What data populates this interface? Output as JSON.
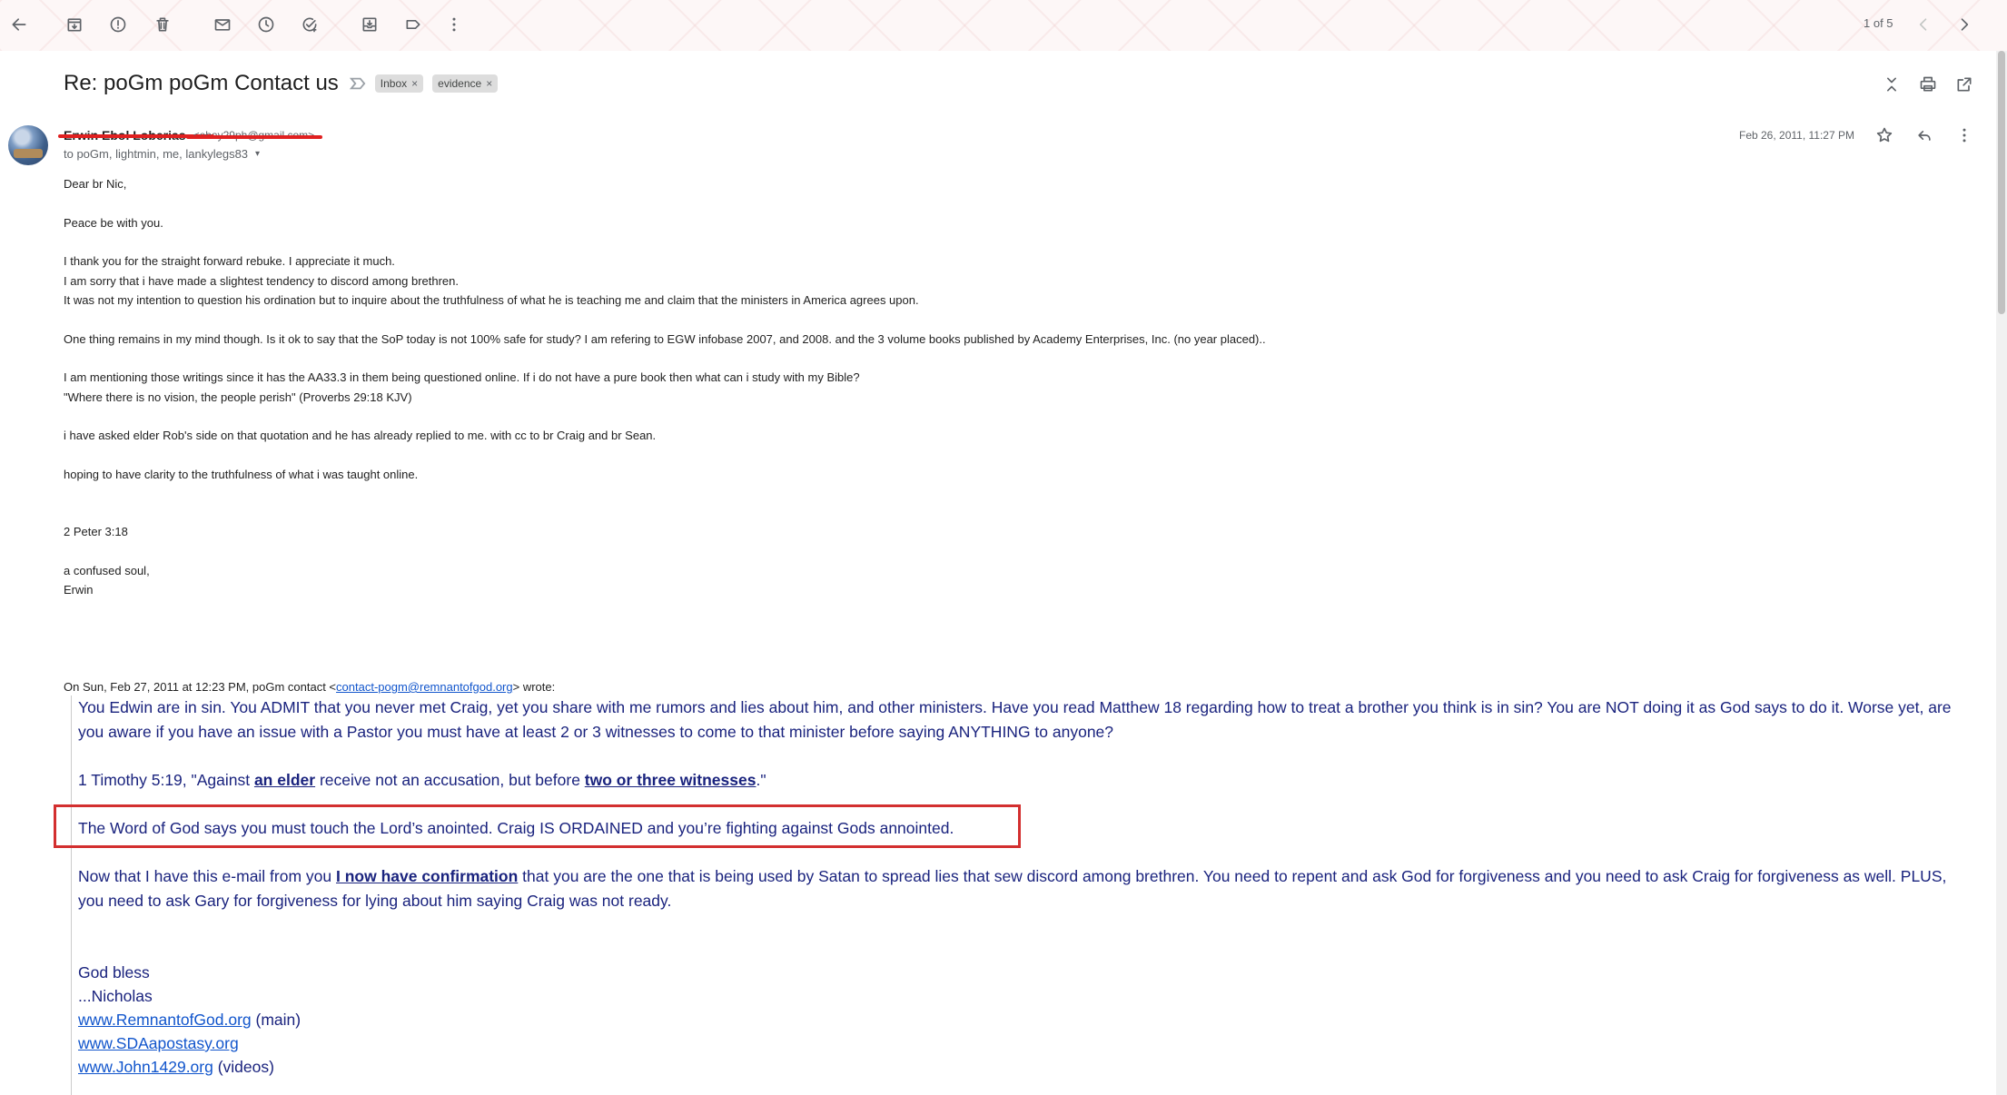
{
  "toolbar": {
    "icons": [
      "back-arrow-icon",
      "archive-icon",
      "report-spam-icon",
      "delete-icon",
      "mark-unread-icon",
      "snooze-icon",
      "add-to-tasks-icon",
      "move-to-icon",
      "labels-icon",
      "more-vert-icon"
    ],
    "pager": "1 of 5"
  },
  "subject": {
    "title": "Re: poGm poGm Contact us",
    "labels": [
      "Inbox",
      "evidence"
    ],
    "close_x": "×"
  },
  "sender": {
    "name": "Erwin  Ebol  Loberias",
    "email": "<ebay29ph@gmail.com>",
    "recipients": "to poGm, lightmin, me, lankylegs83",
    "date": "Feb 26, 2011, 11:27 PM",
    "caret": "▾"
  },
  "body": {
    "greeting": "Dear br Nic,",
    "peace": "Peace be with you.",
    "p1_l1": "I thank you for the straight forward rebuke. I appreciate it much.",
    "p1_l2": "I am sorry that i have made a slightest tendency to discord among brethren.",
    "p1_l3": "It was not my intention to question his ordination but to inquire about the truthfulness of what he is teaching me and claim that the ministers in America agrees upon.",
    "p2": "One thing remains in my mind though. Is it ok to say that the SoP today is not 100% safe for study? I am refering to EGW infobase 2007, and 2008. and the 3 volume books published by Academy Enterprises, Inc. (no year placed)..",
    "p3_l1": "I am mentioning those writings since it has the AA33.3 in them being questioned online. If i do not have a pure book then what can i study with my Bible?",
    "p3_l2": "\"Where there is no vision, the people perish\" (Proverbs 29:18 KJV)",
    "p4": "i have asked elder Rob's side on that quotation and he has already replied to me. with cc to br Craig and br Sean.",
    "p5": "hoping to have clarity to the truthfulness of what i was taught online.",
    "verse": "2 Peter 3:18",
    "closing": "a confused soul,",
    "signoff": "Erwin"
  },
  "quote_header": {
    "prefix": "On Sun, Feb 27, 2011 at 12:23 PM, poGm contact <",
    "email": "contact-pogm@remnantofgod.org",
    "suffix": "> wrote:"
  },
  "quote": {
    "p1": "You Edwin are in sin. You ADMIT that you never met Craig, yet you share with me rumors and lies about him, and other ministers. Have you read Matthew 18 regarding how to treat a brother you think is in sin? You are NOT doing it as God says to do it. Worse yet, are you aware if you have an issue with a Pastor you must have at least 2 or 3 witnesses to come to that minister before saying ANYTHING to anyone?",
    "p2_a": "1 Timothy 5:19, \"Against ",
    "p2_link1": "an elder",
    "p2_b": " receive not an accusation, but before ",
    "p2_link2": "two or three witnesses",
    "p2_c": ".\"",
    "p3": "The Word of God says you must touch the Lord’s anointed. Craig IS ORDAINED and you’re fighting against Gods annointed.",
    "p4_a": "Now that I have this e-mail from you ",
    "p4_link": "I now have confirmation",
    "p4_b": " that you are the one that is being used by Satan to spread lies that sew discord among brethren. You need to repent and ask God for forgiveness and you need to ask Craig for forgiveness as well. PLUS, you need to ask Gary for forgiveness for lying about him saying Craig was not ready.",
    "sig_1": "God bless",
    "sig_2": "...Nicholas",
    "url1": "www.RemnantofGod.org",
    "url1_note": " (main)",
    "url2": "www.SDAapostasy.org",
    "url3": "www.John1429.org",
    "url3_note": " (videos)"
  },
  "colors": {
    "quote_text": "#1a237e",
    "highlight_box": "#d32f2f",
    "redaction": "#e02020",
    "link": "#1155cc"
  }
}
